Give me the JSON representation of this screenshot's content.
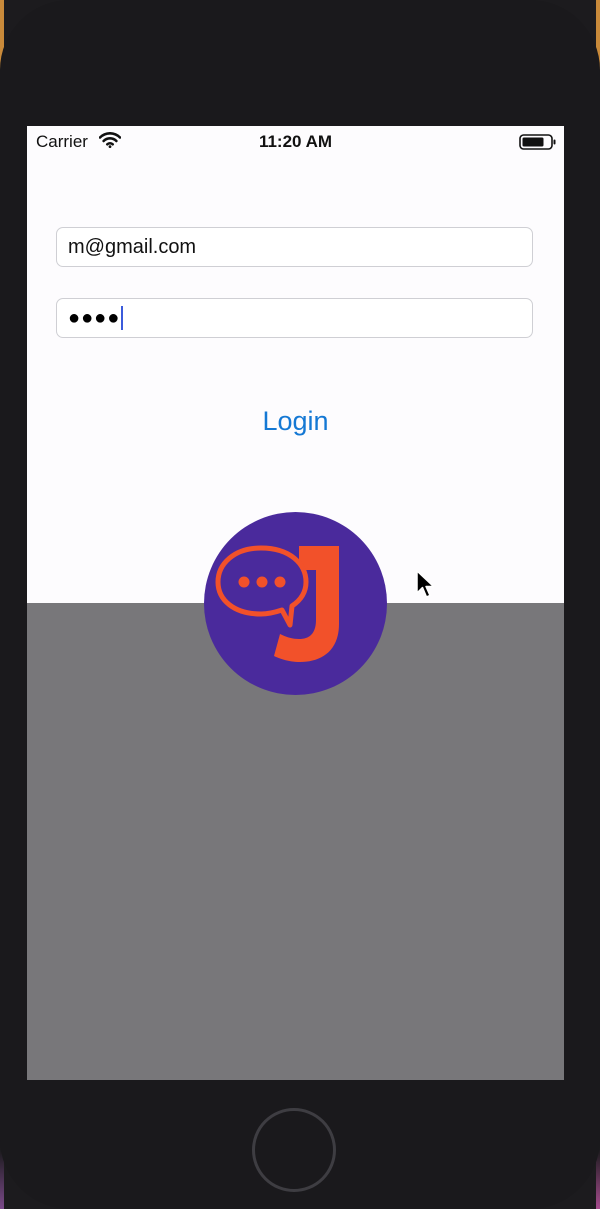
{
  "status_bar": {
    "carrier": "Carrier",
    "time": "11:20 AM",
    "wifi_icon": "wifi-icon",
    "battery_icon": "battery-icon"
  },
  "login_form": {
    "email_value": "m@gmail.com",
    "password_masked": "●●●●",
    "login_label": "Login"
  },
  "logo": {
    "name": "chat-bubble-J-logo",
    "background_color": "#4a2a9c",
    "accent_color": "#f2512a"
  },
  "colors": {
    "link_blue": "#1478d4",
    "lower_panel": "#78777a",
    "device_frame": "#1a191c"
  }
}
